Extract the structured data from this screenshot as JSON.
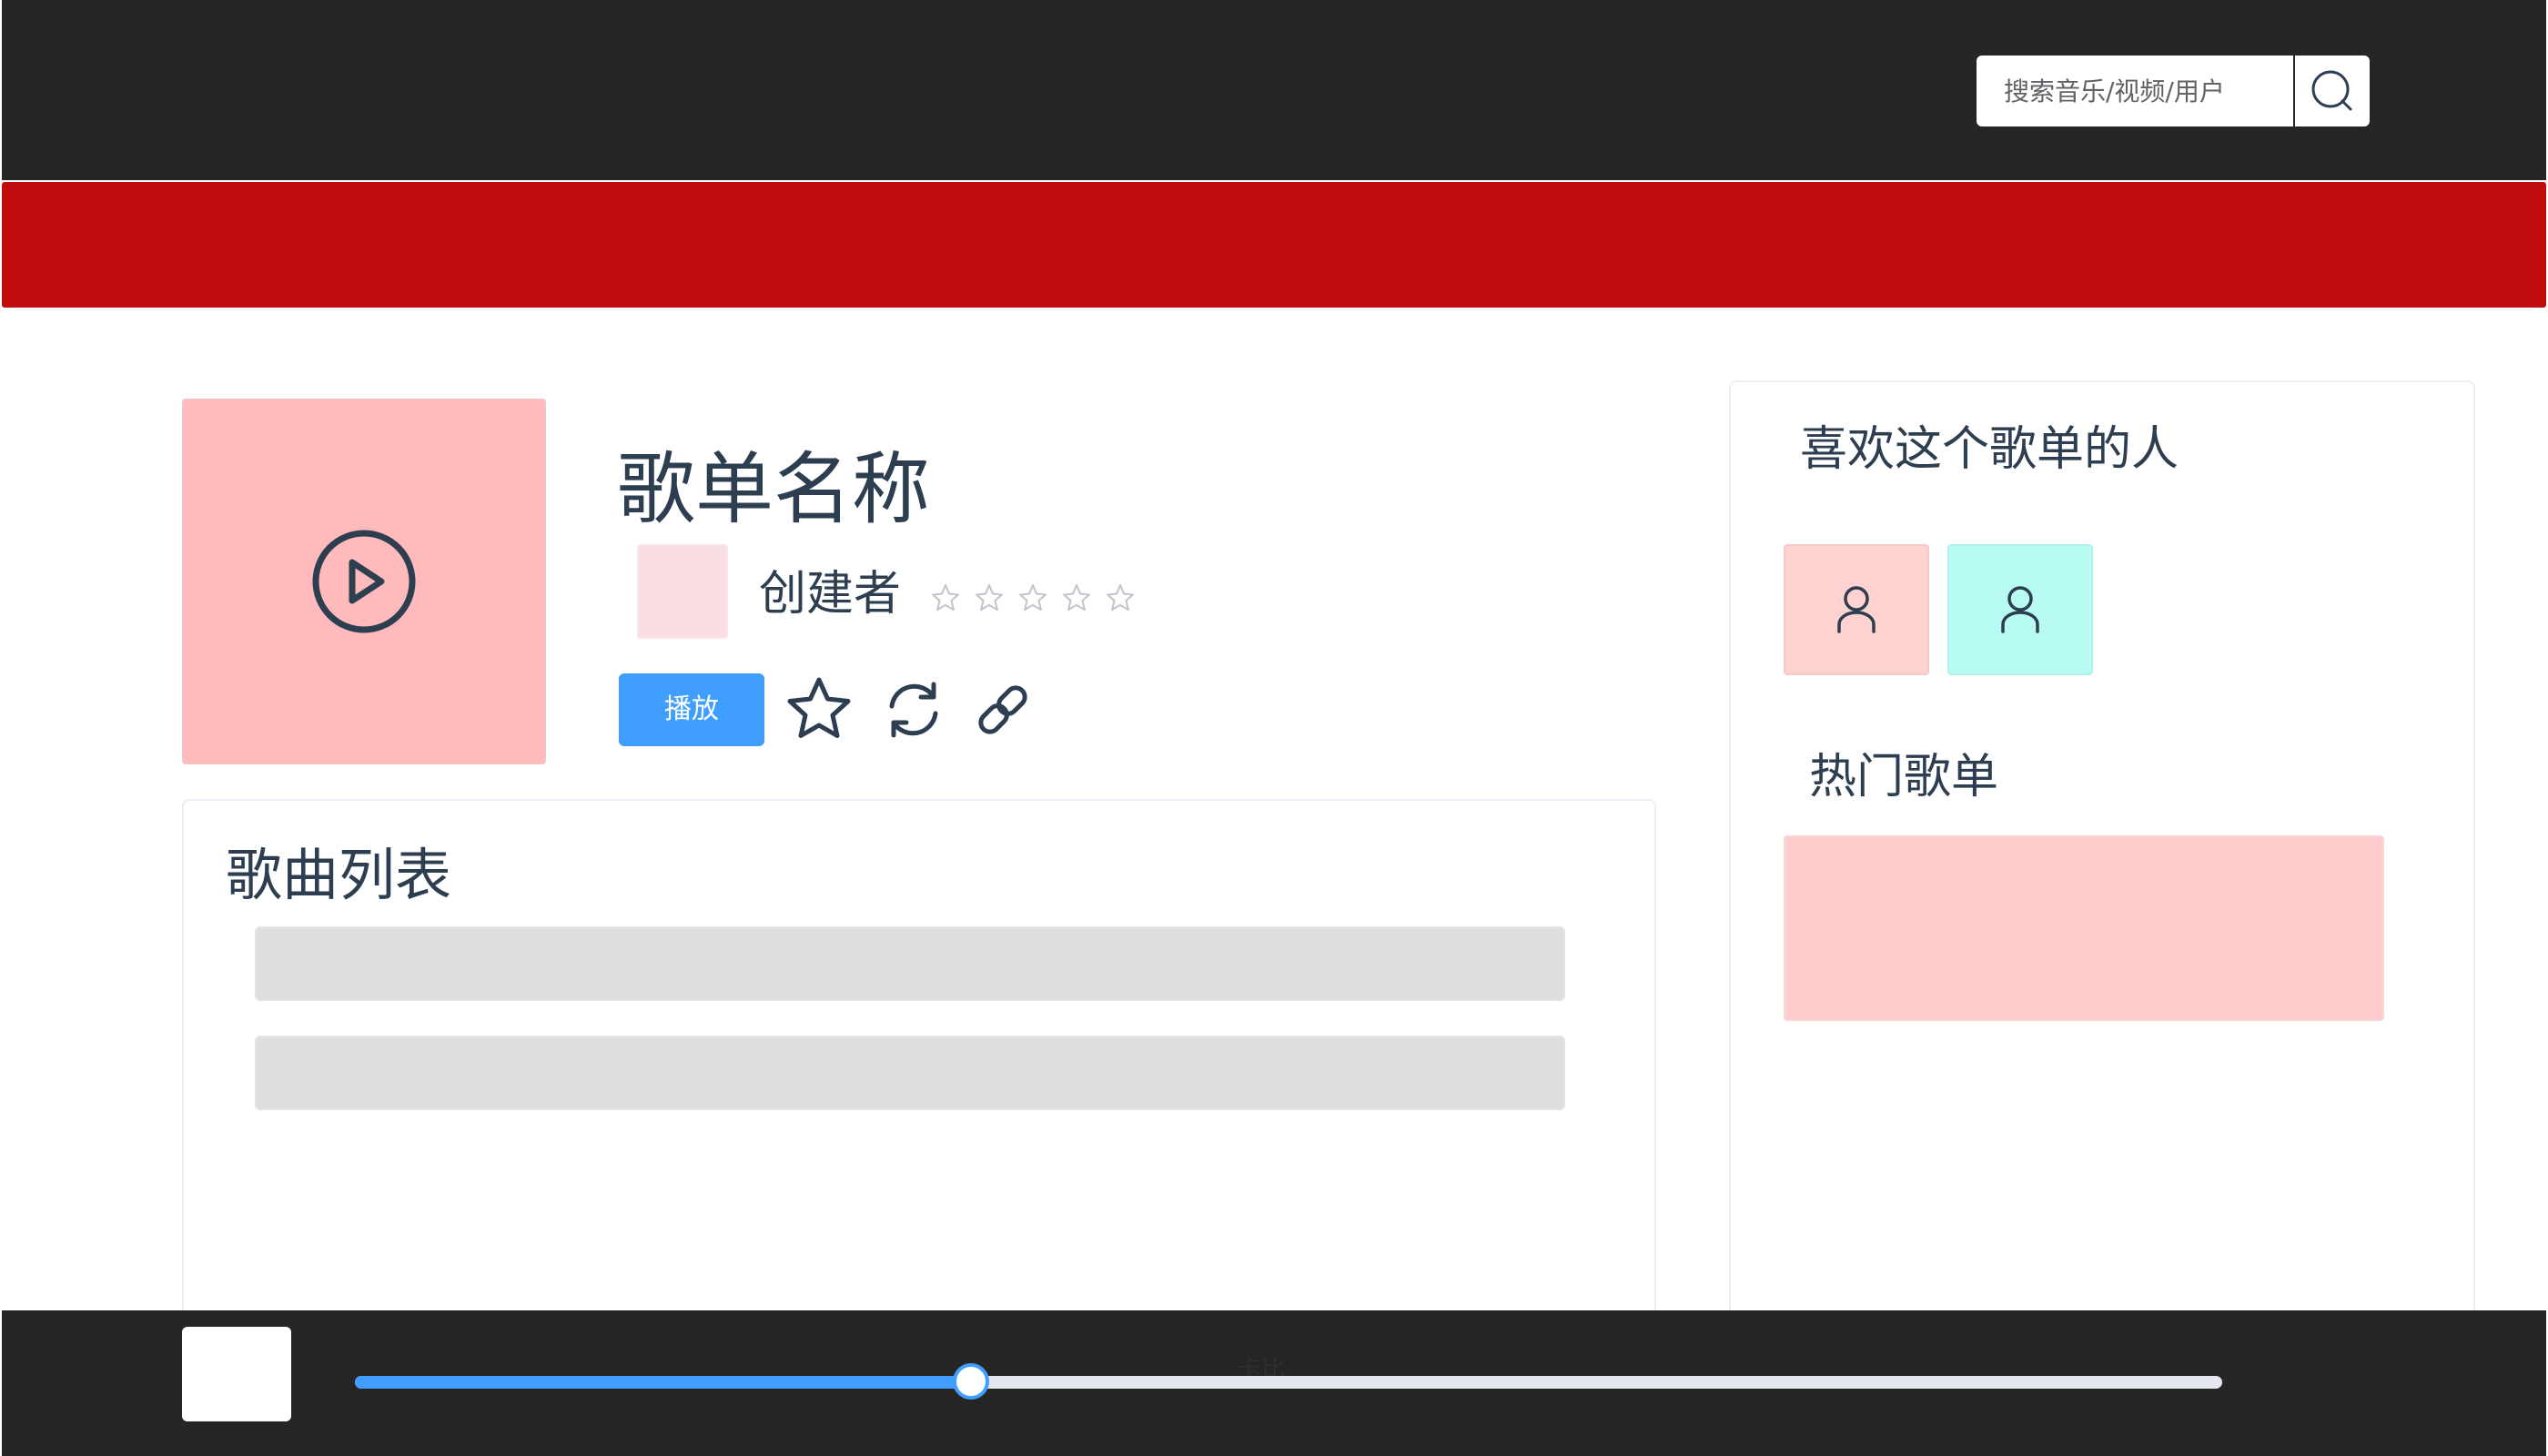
{
  "header": {
    "search_placeholder": "搜索音乐/视频/用户"
  },
  "playlist": {
    "title": "歌单名称",
    "creator": "创建者",
    "rating_stars": 5,
    "rating_value": 0,
    "play_label": "播放"
  },
  "songs": {
    "title": "歌曲列表"
  },
  "sidebar": {
    "likers_title": "喜欢这个歌单的人",
    "likers": [
      {
        "color": "#ffd2d2"
      },
      {
        "color": "#b8fbf3"
      }
    ],
    "hot_title": "热门歌单"
  },
  "player": {
    "track": "卡比",
    "progress": 0.33
  },
  "colors": {
    "topbar": "#252525",
    "banner": "#c10c0d",
    "accent": "#409eff",
    "cover": "#ffbbbb"
  }
}
